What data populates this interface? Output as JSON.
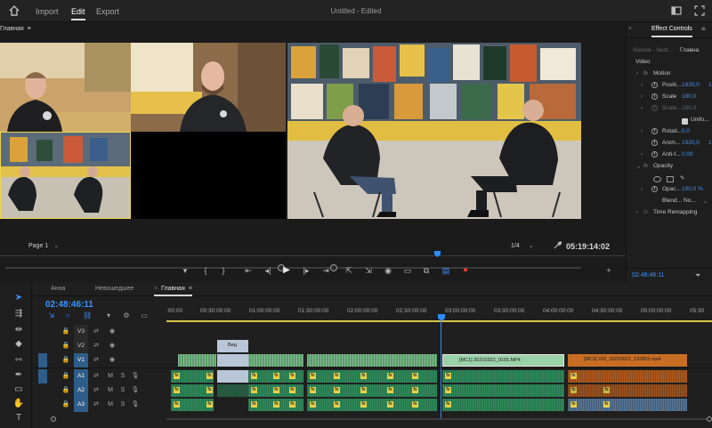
{
  "topbar": {
    "tabs": [
      {
        "label": "Import"
      },
      {
        "label": "Edit"
      },
      {
        "label": "Export"
      }
    ],
    "title": "Untitled - Edited"
  },
  "monitor": {
    "label": "Главная",
    "page_select": "Page 1",
    "zoom_select": "1/4",
    "timecode": "05:19:14:02",
    "playhead_fraction": 0.694
  },
  "effect_controls": {
    "panel_label": "Effect Controls",
    "source": "Source - Nest...",
    "sequence": "Главна",
    "section": "Video",
    "rows": [
      {
        "name": "Motion",
        "value": ""
      },
      {
        "name": "Positi...",
        "value": "1920,0"
      },
      {
        "name": "Scale",
        "value": "100,0"
      },
      {
        "name": "Scale...",
        "value": "100,0"
      },
      {
        "name": "Unifo...",
        "value": ""
      },
      {
        "name": "Rotati...",
        "value": "0,0"
      },
      {
        "name": "Anch...",
        "value": "1920,0"
      },
      {
        "name": "Anti-f...",
        "value": "0,00"
      },
      {
        "name": "Opacity",
        "value": ""
      },
      {
        "name": "Opac...",
        "value": "100,0 %"
      },
      {
        "name": "Blend...",
        "value": "No..."
      },
      {
        "name": "Time Remapping",
        "value": ""
      }
    ],
    "position_y": "1",
    "anchor_y": "1",
    "timecode": "02:48:46:11"
  },
  "timeline": {
    "tabs": [
      {
        "label": "Анна"
      },
      {
        "label": "Невошедшее"
      },
      {
        "label": "Главная"
      }
    ],
    "timecode": "02:48:46:11",
    "ruler": [
      ":00:00",
      "00:30:00:00",
      "01:00:00:00",
      "01:30:00:00",
      "02:00:00:00",
      "02:30:00:00",
      "03:00:00:00",
      "03:30:00:00",
      "04:00:00:00",
      "04:30:00:00",
      "05:00:00:00",
      "05:30"
    ],
    "video_tracks": [
      {
        "label": "V3"
      },
      {
        "label": "V2"
      },
      {
        "label": "V1"
      }
    ],
    "audio_tracks": [
      {
        "label": "A1"
      },
      {
        "label": "A2"
      },
      {
        "label": "A3"
      }
    ],
    "mute_label": "M",
    "solo_label": "S",
    "clips": {
      "v2_clip": "Вид",
      "v1_clip_a": "[MC1] 20210322_0155.MP4",
      "v1_clip_b": "[MC3] VID_20220622_132853.mp4"
    }
  },
  "colors": {
    "accent": "#2f8cff",
    "workbar": "#d9c34a",
    "clip_green": "#2e8f5c",
    "clip_orange": "#b65a1e",
    "record": "#e03a3a"
  }
}
